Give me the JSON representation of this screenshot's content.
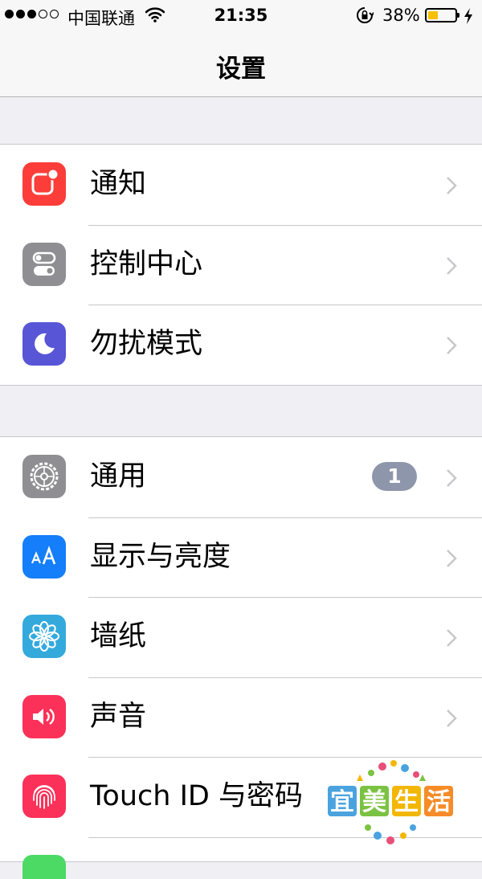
{
  "status_bar": {
    "carrier": "中国联通",
    "time": "21:35",
    "battery_percent": "38%",
    "battery_level": 0.38,
    "signal_bars": 3,
    "signal_total": 5,
    "battery_color": "#f8c000"
  },
  "nav": {
    "title": "设置"
  },
  "groups": [
    {
      "rows": [
        {
          "label": "通知",
          "icon": "notifications-icon",
          "color": "#fc3d39"
        },
        {
          "label": "控制中心",
          "icon": "control-center-icon",
          "color": "#8e8e93"
        },
        {
          "label": "勿扰模式",
          "icon": "do-not-disturb-icon",
          "color": "#5856d6"
        }
      ]
    },
    {
      "rows": [
        {
          "label": "通用",
          "icon": "general-gear-icon",
          "color": "#8e8e93",
          "badge": "1"
        },
        {
          "label": "显示与亮度",
          "icon": "display-brightness-icon",
          "color": "#147efb"
        },
        {
          "label": "墙纸",
          "icon": "wallpaper-flower-icon",
          "color": "#34aadc"
        },
        {
          "label": "声音",
          "icon": "sounds-speaker-icon",
          "color": "#fc3159"
        },
        {
          "label": "Touch ID 与密码",
          "icon": "touch-id-fingerprint-icon",
          "color": "#fc3159"
        }
      ]
    }
  ],
  "badge_color": "#8e96ab",
  "chevron_color": "#c7c7cc",
  "watermark": {
    "text": "宜美生活"
  }
}
